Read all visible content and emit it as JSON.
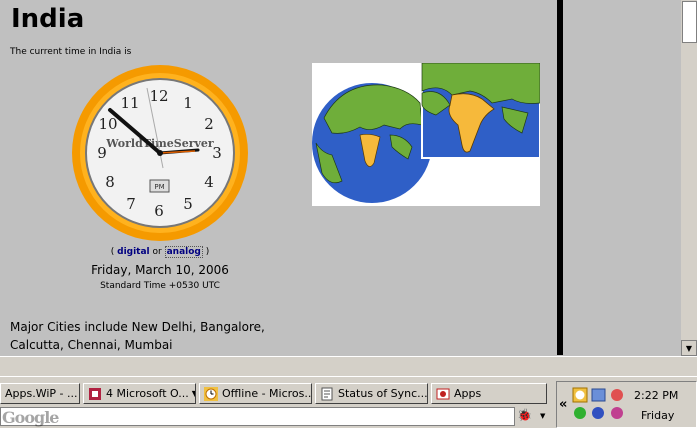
{
  "page": {
    "title": "India",
    "intro": "The current time in India is",
    "clock_brand": "WorldTimeServer",
    "clock_ampm": "PM",
    "clock_numbers": [
      "12",
      "1",
      "2",
      "3",
      "4",
      "5",
      "6",
      "7",
      "8",
      "9",
      "10",
      "11"
    ],
    "links": {
      "open": "(",
      "digital": "digital",
      "or": "or",
      "analog": "analog",
      "close": ")"
    },
    "date": "Friday, March 10, 2006",
    "timezone": "Standard Time +0530 UTC",
    "cities_line1": "Major Cities include New Delhi, Bangalore,",
    "cities_line2": "Calcutta, Chennai, Mumbai"
  },
  "taskbar": {
    "items": [
      {
        "label": "Apps.WiP - ..."
      },
      {
        "label": "4 Microsoft O..."
      },
      {
        "label": "Offline - Micros..."
      },
      {
        "label": "Status of Sync..."
      },
      {
        "label": "Apps"
      }
    ],
    "tray": {
      "time": "2:22 PM",
      "day": "Friday",
      "expand": "«"
    },
    "search_logo": "Google"
  },
  "colors": {
    "clock_ring": "#f59a00",
    "map_land": "#f6b93b",
    "ocean": "#2f5fc7"
  }
}
